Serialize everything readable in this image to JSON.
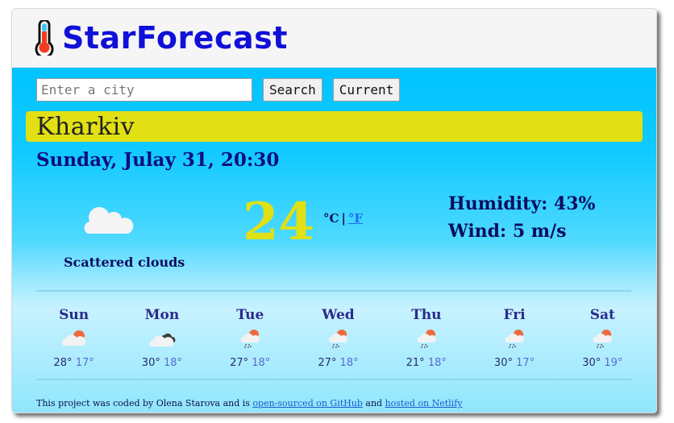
{
  "header": {
    "brand": "StarForecast",
    "logo_icon": "thermometer-icon"
  },
  "search": {
    "placeholder": "Enter a city",
    "value": "",
    "search_label": "Search",
    "current_label": "Current"
  },
  "current": {
    "city": "Kharkiv",
    "datetime": "Sunday, Julay 31, 20:30",
    "icon": "scattered-clouds-icon",
    "description": "Scattered clouds",
    "temperature": "24",
    "unit_celsius": "°C",
    "unit_separator": "|",
    "unit_fahrenheit": "°F",
    "humidity": "Humidity: 43%",
    "wind": "Wind: 5 m/s"
  },
  "forecast": [
    {
      "day": "Sun",
      "icon": "few-clouds-day-icon",
      "max": "28°",
      "min": "17°"
    },
    {
      "day": "Mon",
      "icon": "broken-clouds-icon",
      "max": "30°",
      "min": "18°"
    },
    {
      "day": "Tue",
      "icon": "rain-day-icon",
      "max": "27°",
      "min": "18°"
    },
    {
      "day": "Wed",
      "icon": "rain-day-icon",
      "max": "27°",
      "min": "18°"
    },
    {
      "day": "Thu",
      "icon": "rain-day-icon",
      "max": "21°",
      "min": "18°"
    },
    {
      "day": "Fri",
      "icon": "rain-day-icon",
      "max": "30°",
      "min": "17°"
    },
    {
      "day": "Sat",
      "icon": "rain-day-icon",
      "max": "30°",
      "min": "19°"
    }
  ],
  "footer": {
    "text_before": "This project was coded by Olena Starova and is ",
    "github_link": "open-sourced on GitHub",
    "text_middle": " and ",
    "netlify_link": "hosted on Netlify"
  },
  "colors": {
    "brand": "#1010d8",
    "city_bar": "#e0e014",
    "temperature": "#e0e014",
    "background_top": "#00c3ff",
    "text_dark": "#0d0d60",
    "link": "#1a6cf0",
    "sun": "#f06a40"
  }
}
